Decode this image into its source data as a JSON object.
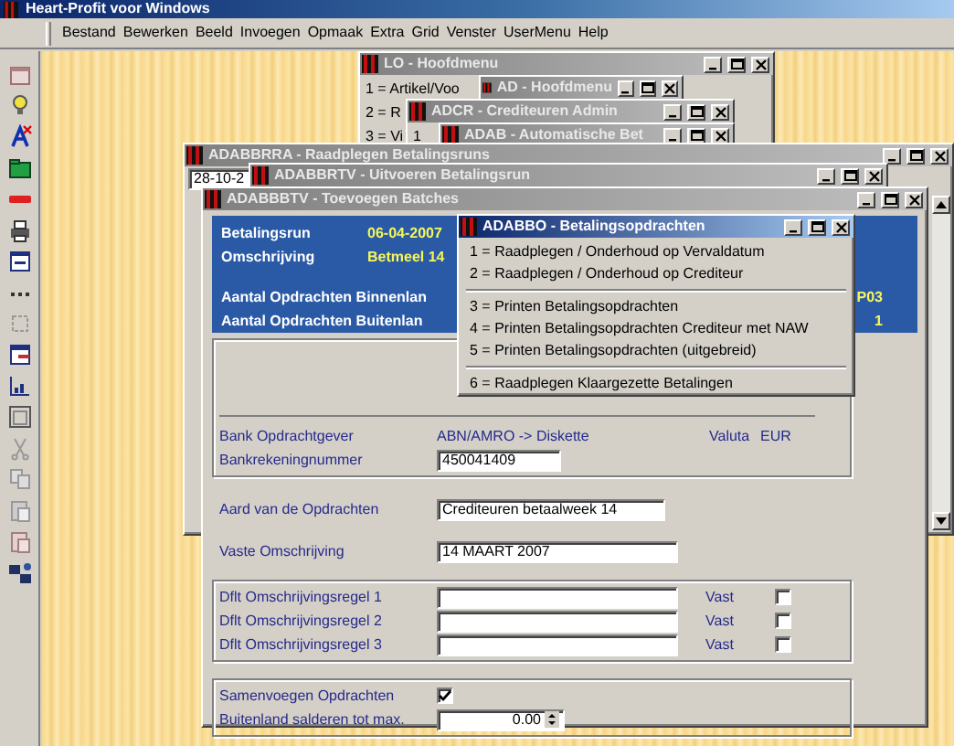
{
  "window": {
    "title": "Heart-Profit voor Windows"
  },
  "menu": [
    "Bestand",
    "Bewerken",
    "Beeld",
    "Invoegen",
    "Opmaak",
    "Extra",
    "Grid",
    "Venster",
    "UserMenu",
    "Help"
  ],
  "windows": [
    {
      "title": "LO - Hoofdmenu",
      "active": false,
      "items": [
        "1 = Artikel/Voo",
        "2 = R",
        "3 = Vi"
      ]
    },
    {
      "title": "AD - Hoofdmenu",
      "active": false
    },
    {
      "title": "ADCR - Crediteuren Admin",
      "active": false,
      "items": [
        "1"
      ]
    },
    {
      "title": "ADAB - Automatische Bet",
      "active": false
    },
    {
      "title": "ADABBRRA - Raadplegen Betalingsruns",
      "active": false,
      "date_field": {
        "value": "28-10-2"
      }
    },
    {
      "title": "ADABBRTV - Uitvoeren Betalingsrun",
      "active": false
    }
  ],
  "batch_window": {
    "title": "ADABBBTV - Toevoegen Batches",
    "active": false,
    "summary": [
      {
        "label": "Betalingsrun",
        "value": "06-04-2007",
        "kind": "inline"
      },
      {
        "label": "Omschrijving",
        "value": "Betmeel 14",
        "kind": "inline"
      },
      {
        "label": "Aantal Opdrachten Binnenlan",
        "value": "P03",
        "kind": "right"
      },
      {
        "label": "Aantal Opdrachten Buitenlan",
        "value": "1",
        "kind": "right"
      }
    ],
    "bank": {
      "label": "Bank Opdrachtgever",
      "value": "ABN/AMRO -> Diskette",
      "currency_label": "Valuta",
      "currency_value": "EUR"
    },
    "account": {
      "label": "Bankrekeningnummer",
      "value": "450041409"
    },
    "order_type": {
      "label": "Aard van de Opdrachten",
      "value": "Crediteuren betaalweek 14"
    },
    "fixed_description": {
      "label": "Vaste Omschrijving",
      "value": "14 MAART 2007"
    },
    "default_lines": [
      {
        "label": "Dflt Omschrijvingsregel 1",
        "fixed_label": "Vast",
        "checked": false
      },
      {
        "label": "Dflt Omschrijvingsregel 2",
        "fixed_label": "Vast",
        "checked": false
      },
      {
        "label": "Dflt Omschrijvingsregel 3",
        "fixed_label": "Vast",
        "checked": false
      }
    ],
    "merge_orders": {
      "label": "Samenvoegen Opdrachten",
      "checked": true
    },
    "max_balance": {
      "label": "Buitenland salderen tot max.",
      "value": "0.00"
    }
  },
  "popup": {
    "title": "ADABBO - Betalingsopdrachten",
    "active": true,
    "groups": [
      [
        "1 = Raadplegen / Onderhoud op Vervaldatum",
        "2 = Raadplegen / Onderhoud op Crediteur"
      ],
      [
        "3 = Printen Betalingsopdrachten",
        "4 = Printen Betalingsopdrachten Crediteur met NAW",
        "5 = Printen Betalingsopdrachten (uitgebreid)"
      ],
      [
        "6 = Raadplegen Klaargezette Betalingen"
      ]
    ]
  }
}
